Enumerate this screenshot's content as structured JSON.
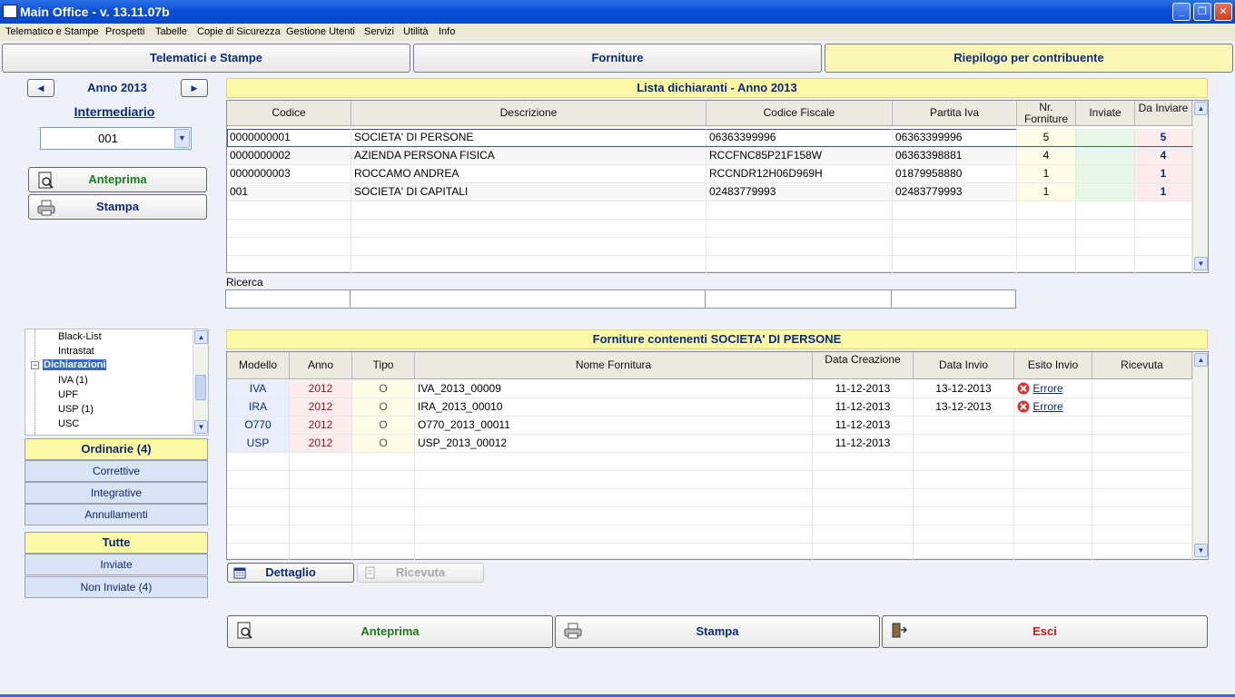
{
  "window": {
    "title": "Main Office - v. 13.11.07b"
  },
  "menu": [
    "Telematico e Stampe",
    "Prospetti",
    "Tabelle",
    "Copie di Sicurezza",
    "Gestione Utenti",
    "Servizi",
    "Utilità",
    "Info"
  ],
  "tabs": [
    {
      "label": "Telematici e Stampe"
    },
    {
      "label": "Forniture"
    },
    {
      "label": "Riepilogo per contribuente"
    }
  ],
  "year": {
    "label": "Anno 2013"
  },
  "intermediario": {
    "label": "Intermediario",
    "value": "001"
  },
  "left_actions": {
    "anteprima": "Anteprima",
    "stampa": "Stampa"
  },
  "dichiaranti": {
    "title": "Lista dichiaranti - Anno 2013",
    "columns": [
      "Codice",
      "Descrizione",
      "Codice Fiscale",
      "Partita Iva",
      "Nr. Forniture",
      "Inviate",
      "Da Inviare"
    ],
    "rows": [
      {
        "codice": "0000000001",
        "descrizione": "SOCIETA' DI PERSONE",
        "cf": "06363399996",
        "piva": "06363399996",
        "nr": "5",
        "inviate": "",
        "da_inviare": "5"
      },
      {
        "codice": "0000000002",
        "descrizione": "AZIENDA PERSONA FISICA",
        "cf": "RCCFNC85P21F158W",
        "piva": "06363398881",
        "nr": "4",
        "inviate": "",
        "da_inviare": "4"
      },
      {
        "codice": "0000000003",
        "descrizione": "ROCCAMO ANDREA",
        "cf": "RCCNDR12H06D969H",
        "piva": "01879958880",
        "nr": "1",
        "inviate": "",
        "da_inviare": "1"
      },
      {
        "codice": "001",
        "descrizione": "SOCIETA' DI CAPITALI",
        "cf": "02483779993",
        "piva": "02483779993",
        "nr": "1",
        "inviate": "",
        "da_inviare": "1"
      }
    ]
  },
  "ricerca": {
    "label": "Ricerca"
  },
  "tree": {
    "items": [
      {
        "label": "Black-List",
        "level": 2
      },
      {
        "label": "Intrastat",
        "level": 2
      },
      {
        "label": "Dichiarazioni",
        "level": 1,
        "selected": true
      },
      {
        "label": "IVA (1)",
        "level": 2
      },
      {
        "label": "UPF",
        "level": 2
      },
      {
        "label": "USP (1)",
        "level": 2
      },
      {
        "label": "USC",
        "level": 2
      }
    ]
  },
  "filters1": [
    "Ordinarie (4)",
    "Correttive",
    "Integrative",
    "Annullamenti"
  ],
  "filters2": [
    "Tutte",
    "Inviate",
    "Non Inviate (4)"
  ],
  "forniture": {
    "title": "Forniture contenenti SOCIETA' DI PERSONE",
    "columns": [
      "Modello",
      "Anno",
      "Tipo",
      "Nome Fornitura",
      "Data Creazione",
      "Data Invio",
      "Esito Invio",
      "Ricevuta"
    ],
    "rows": [
      {
        "modello": "IVA",
        "anno": "2012",
        "tipo": "O",
        "nome": "IVA_2013_00009",
        "creazione": "11-12-2013",
        "invio": "13-12-2013",
        "esito": "Errore",
        "ricevuta": ""
      },
      {
        "modello": "IRA",
        "anno": "2012",
        "tipo": "O",
        "nome": "IRA_2013_00010",
        "creazione": "11-12-2013",
        "invio": "13-12-2013",
        "esito": "Errore",
        "ricevuta": ""
      },
      {
        "modello": "O770",
        "anno": "2012",
        "tipo": "O",
        "nome": "O770_2013_00011",
        "creazione": "11-12-2013",
        "invio": "",
        "esito": "",
        "ricevuta": ""
      },
      {
        "modello": "USP",
        "anno": "2012",
        "tipo": "O",
        "nome": "USP_2013_00012",
        "creazione": "11-12-2013",
        "invio": "",
        "esito": "",
        "ricevuta": ""
      }
    ]
  },
  "detail_buttons": {
    "dettaglio": "Dettaglio",
    "ricevuta": "Ricevuta"
  },
  "bottom_buttons": {
    "anteprima": "Anteprima",
    "stampa": "Stampa",
    "esci": "Esci"
  },
  "colors": {
    "title_bar": "#0a4fd8",
    "tab_active": "#fbf8b6",
    "header_yellow": "#fcf9a6",
    "filter_blue": "#d9e4f7",
    "anteprima_text": "#1c7a1c",
    "esci_text": "#d01818",
    "error_red": "#d93030"
  }
}
